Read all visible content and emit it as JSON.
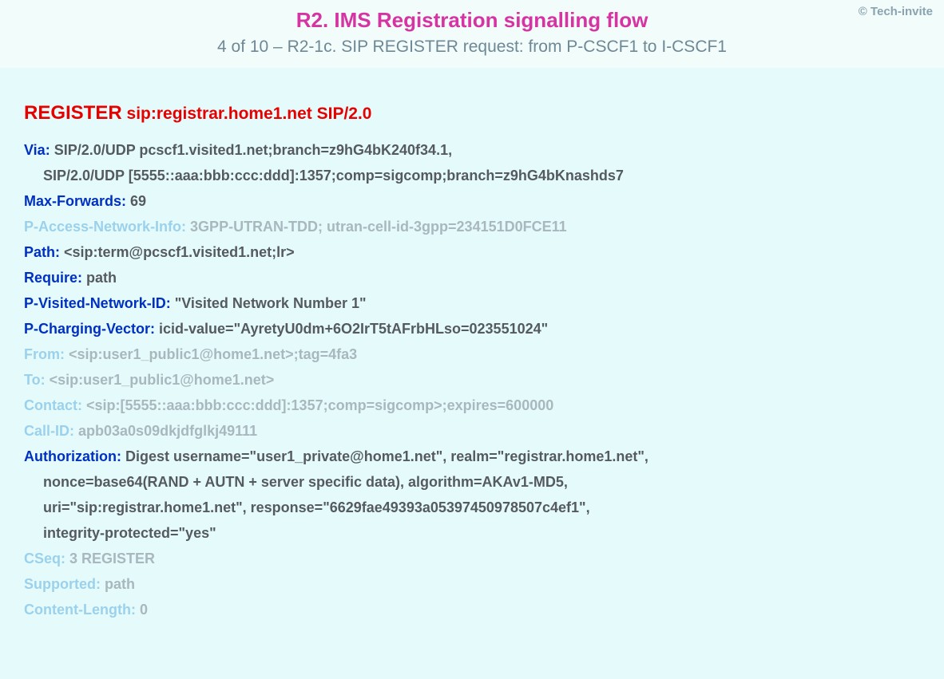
{
  "copyright": "© Tech-invite",
  "title": "R2. IMS Registration signalling flow",
  "subtitle": "4 of 10 – R2-1c. SIP REGISTER request: from P-CSCF1 to I-CSCF1",
  "request": {
    "method": "REGISTER",
    "uri": "sip:registrar.home1.net SIP/2.0"
  },
  "headers": {
    "via_label": "Via",
    "via_line1": "SIP/2.0/UDP pcscf1.visited1.net;branch=z9hG4bK240f34.1,",
    "via_line2": "SIP/2.0/UDP [5555::aaa:bbb:ccc:ddd]:1357;comp=sigcomp;branch=z9hG4bKnashds7",
    "maxfwd_label": "Max-Forwards",
    "maxfwd_val": "69",
    "pani_label": "P-Access-Network-Info",
    "pani_val": "3GPP-UTRAN-TDD; utran-cell-id-3gpp=234151D0FCE11",
    "path_label": "Path",
    "path_val": "<sip:term@pcscf1.visited1.net;lr>",
    "require_label": "Require",
    "require_val": "path",
    "pvni_label": "P-Visited-Network-ID",
    "pvni_val": "\"Visited Network Number 1\"",
    "pcv_label": "P-Charging-Vector",
    "pcv_val": "icid-value=\"AyretyU0dm+6O2IrT5tAFrbHLso=023551024\"",
    "from_label": "From",
    "from_val": "<sip:user1_public1@home1.net>;tag=4fa3",
    "to_label": "To",
    "to_val": "<sip:user1_public1@home1.net>",
    "contact_label": "Contact",
    "contact_val": "<sip:[5555::aaa:bbb:ccc:ddd]:1357;comp=sigcomp>;expires=600000",
    "callid_label": "Call-ID",
    "callid_val": "apb03a0s09dkjdfglkj49111",
    "auth_label": "Authorization",
    "auth_line1": "Digest username=\"user1_private@home1.net\", realm=\"registrar.home1.net\",",
    "auth_line2": "nonce=base64(RAND + AUTN + server specific data), algorithm=AKAv1-MD5,",
    "auth_line3": "uri=\"sip:registrar.home1.net\", response=\"6629fae49393a05397450978507c4ef1\",",
    "auth_line4": "integrity-protected=\"yes\"",
    "cseq_label": "CSeq",
    "cseq_val": "3 REGISTER",
    "supported_label": "Supported",
    "supported_val": "path",
    "cl_label": "Content-Length",
    "cl_val": "0"
  }
}
